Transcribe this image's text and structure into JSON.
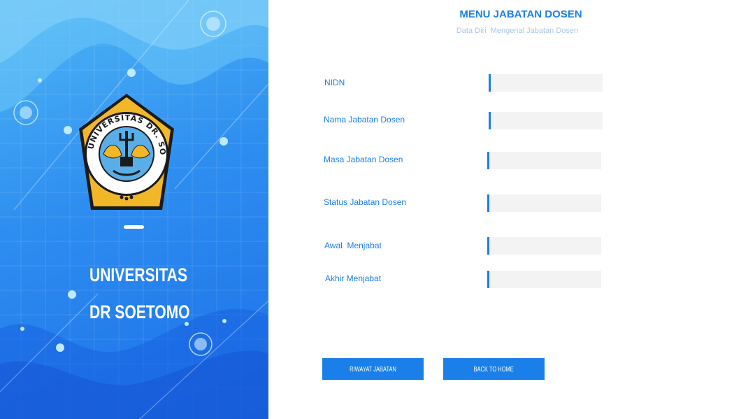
{
  "sidebar": {
    "university_line1": "UNIVERSITAS",
    "university_line2": "DR SOETOMO",
    "logo_text": "UNIVERSITAS DR. SOETOMO",
    "accent": "#1a7fe8",
    "logo_gold": "#f2b728"
  },
  "header": {
    "title": "MENU JABATAN DOSEN",
    "subtitle": "Data Diri  Mengenal Jabatan Dosen"
  },
  "form": {
    "fields": [
      {
        "label": "NIDN",
        "value": ""
      },
      {
        "label": "Nama Jabatan Dosen",
        "value": ""
      },
      {
        "label": "Masa Jabatan Dosen",
        "value": ""
      },
      {
        "label": "Status Jabatan Dosen",
        "value": ""
      },
      {
        "label": "Awal  Menjabat",
        "value": ""
      },
      {
        "label": "Akhir Menjabat",
        "value": ""
      }
    ]
  },
  "buttons": {
    "history": "RIWAYAT JABATAN",
    "back": "BACK TO HOME"
  }
}
